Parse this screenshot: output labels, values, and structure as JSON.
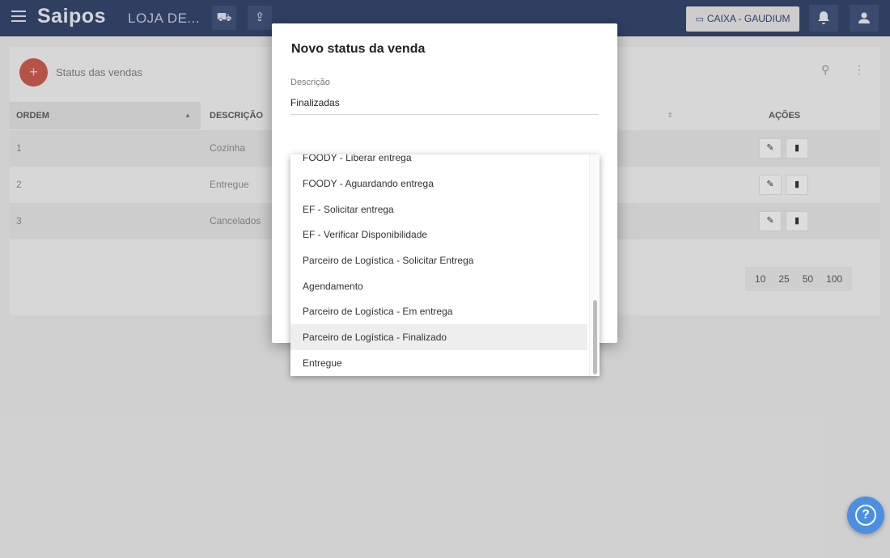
{
  "header": {
    "logo": "Saipos",
    "store_name": "LOJA DE...",
    "icon_1": "⛟",
    "icon_2": "⇪",
    "caixa_label": "CAIXA - GAUDIUM",
    "caixa_icon": "▭",
    "bell_icon": "🔔",
    "user_icon": "👤"
  },
  "page": {
    "title": "Status das vendas",
    "add_icon": "+",
    "search_icon": "⚲",
    "more_icon": "⋮"
  },
  "table": {
    "headers": {
      "ordem": "ORDEM",
      "descricao": "DESCRIÇÃO",
      "acoes": "AÇÕES"
    },
    "sort_asc": "▲",
    "sort_both": "⇕",
    "rows": [
      {
        "ordem": "1",
        "descricao": "Cozinha"
      },
      {
        "ordem": "2",
        "descricao": "Entregue"
      },
      {
        "ordem": "3",
        "descricao": "Cancelados"
      }
    ],
    "edit_icon": "✎",
    "delete_icon": "▮",
    "pagination": [
      "10",
      "25",
      "50",
      "100"
    ]
  },
  "modal": {
    "title": "Novo status da venda",
    "field_label": "Descrição",
    "field_value": "Finalizadas"
  },
  "dropdown": {
    "options": [
      "FOODY - Liberar entrega",
      "FOODY - Aguardando entrega",
      "EF - Solicitar entrega",
      "EF - Verificar Disponibilidade",
      "Parceiro de Logística - Solicitar Entrega",
      "Agendamento",
      "Parceiro de Logística - Em entrega",
      "Parceiro de Logística - Finalizado",
      "Entregue"
    ],
    "highlighted_index": 7
  },
  "help": {
    "icon": "?"
  },
  "colors": {
    "topbar": "#30426a",
    "fab": "#c8594a",
    "help": "#4a8fe2"
  }
}
